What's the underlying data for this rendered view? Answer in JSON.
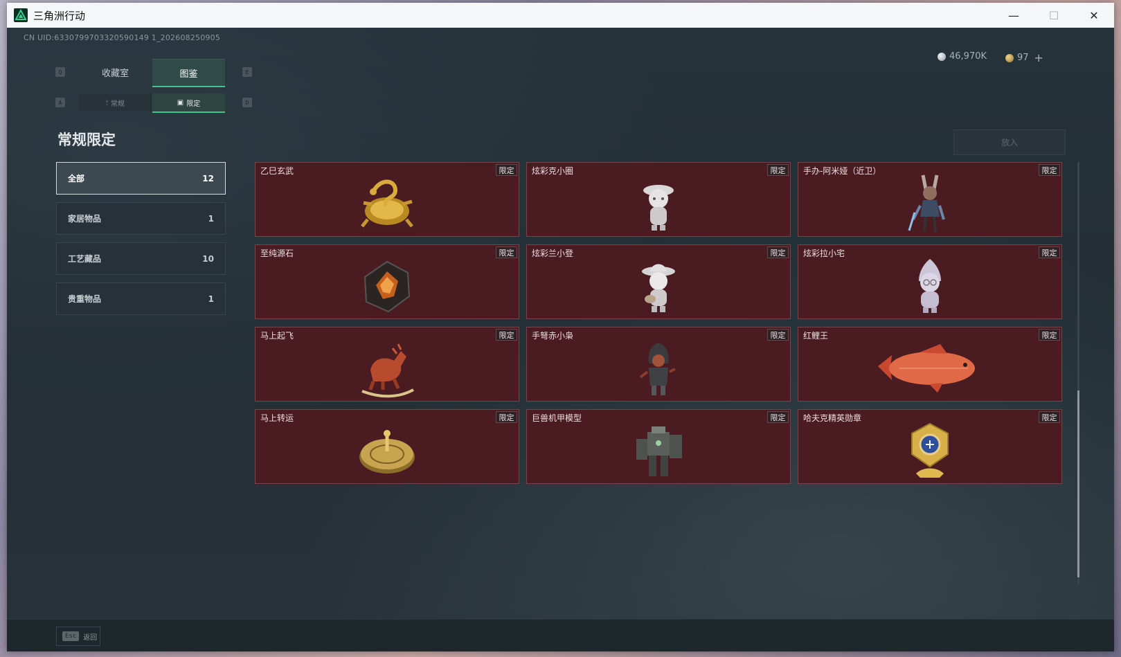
{
  "window": {
    "title": "三角洲行动",
    "min": "—",
    "max": "☐",
    "close": "✕"
  },
  "uid": "CN UID:6330799703320590149 1_202608250905",
  "currency": [
    {
      "icon": "silver-coin-icon",
      "value": "46,970K",
      "color": "#cfd5d8"
    },
    {
      "icon": "gold-coin-icon",
      "value": "97",
      "color": "#c8a45a"
    }
  ],
  "currency_add": "+",
  "main_tabs": [
    {
      "label": "收藏室",
      "active": false
    },
    {
      "label": "图鉴",
      "active": true
    }
  ],
  "main_tab_keys": {
    "left": "Q",
    "right": "E"
  },
  "sub_tabs": [
    {
      "label": "常规",
      "icon": "candle-icon",
      "active": false
    },
    {
      "label": "限定",
      "icon": "image-frame-icon",
      "active": true
    }
  ],
  "sub_tab_keys": {
    "left": "A",
    "right": "D"
  },
  "heading": "常规限定",
  "deposit_button": "放入",
  "categories": [
    {
      "label": "全部",
      "count": "12",
      "active": true
    },
    {
      "label": "家居物品",
      "count": "1",
      "active": false
    },
    {
      "label": "工艺藏品",
      "count": "10",
      "active": false
    },
    {
      "label": "贵重物品",
      "count": "1",
      "active": false
    }
  ],
  "tag_label": "限定",
  "items": [
    {
      "name": "乙巳玄武",
      "icon": "gold-snake-turtle-icon"
    },
    {
      "name": "炫彩克小圈",
      "icon": "cartoon-figure-hat-icon"
    },
    {
      "name": "手办-阿米娅（近卫）",
      "icon": "anime-figure-icon"
    },
    {
      "name": "至纯源石",
      "icon": "crystal-stone-icon"
    },
    {
      "name": "炫彩兰小登",
      "icon": "cartoon-figure-sombrero-icon"
    },
    {
      "name": "炫彩拉小宅",
      "icon": "cartoon-figure-hood-icon"
    },
    {
      "name": "马上起飞",
      "icon": "rocking-horse-icon"
    },
    {
      "name": "手弩赤小枭",
      "icon": "hooded-figure-icon"
    },
    {
      "name": "红鲤王",
      "icon": "red-carp-icon"
    },
    {
      "name": "马上转运",
      "icon": "golden-compass-icon"
    },
    {
      "name": "巨兽机甲模型",
      "icon": "mech-model-icon"
    },
    {
      "name": "哈夫克精英勋章",
      "icon": "elite-medal-icon"
    }
  ],
  "footer": {
    "key": "Esc",
    "label": "返回"
  }
}
